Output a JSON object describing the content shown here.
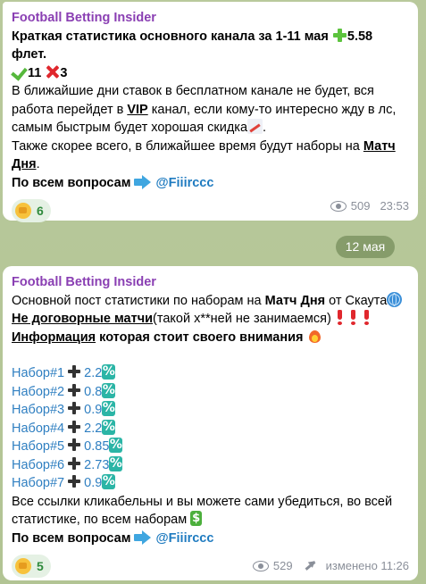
{
  "colors": {
    "sender": "#8a3fb3",
    "link": "#1f7bc0",
    "set": "#2f7fc1"
  },
  "icons": [
    "plus-icon",
    "check-icon",
    "cross-icon",
    "chart-icon",
    "arrow-icon",
    "globe-icon",
    "exclamation-icon",
    "fire-icon",
    "percent-icon",
    "dollar-icon",
    "fist-icon",
    "eye-icon",
    "forward-icon"
  ],
  "messages": [
    {
      "sender": "Football Betting Insider",
      "title_a": "Краткая статистика основного канала за 1-11 мая ",
      "title_b": "5.58",
      "title_c": "флет.",
      "wins": "11",
      "losses": "3",
      "p1_a": "В ближайшие дни ставок в бесплатном канале не будет, вся",
      "p1_b": "работа перейдет в ",
      "p1_vip": "VIP",
      "p1_c": " канал, если кому-то интересно жду в лс,",
      "p1_d": "самым быстрым будет хорошая скидка",
      "p1_e": ".",
      "p2_a": "Также скорее всего, в ближайшее время будут наборы на ",
      "p2_link1": "Матч",
      "p2_link2": "Дня",
      "p2_end": ".",
      "contact_label": "По всем вопросам ",
      "contact_handle": "@Fiiirccc",
      "reaction_count": "6",
      "views": "509",
      "time": "23:53"
    },
    {
      "sender": "Football Betting Insider",
      "l1_a": "Основной пост статистики по наборам на ",
      "l1_b": "Матч Дня",
      "l1_c": " от Скаута",
      "l2_a": "Не договорные матчи",
      "l2_b": "(такой х**ней не занимаемся)",
      "l3_a": "Информация",
      "l3_b": " которая стоит своего внимания",
      "sets": [
        {
          "label": "Набор#1",
          "value": "2.2"
        },
        {
          "label": "Набор#2",
          "value": "0.8"
        },
        {
          "label": "Набор#3",
          "value": "0.9"
        },
        {
          "label": "Набор#4",
          "value": "2.2"
        },
        {
          "label": "Набор#5",
          "value": "0.85"
        },
        {
          "label": "Набор#6",
          "value": "2.73"
        },
        {
          "label": "Набор#7",
          "value": "0.9"
        }
      ],
      "footer_a": "Все ссылки кликабельны и вы можете сами убедиться, во всей",
      "footer_b": "статистике, по всем наборам ",
      "contact_label": "По всем вопросам ",
      "contact_handle": "@Fiiirccc",
      "reaction_count": "5",
      "views": "529",
      "edited": "изменено 11:26"
    }
  ],
  "date_separator": "12 мая"
}
